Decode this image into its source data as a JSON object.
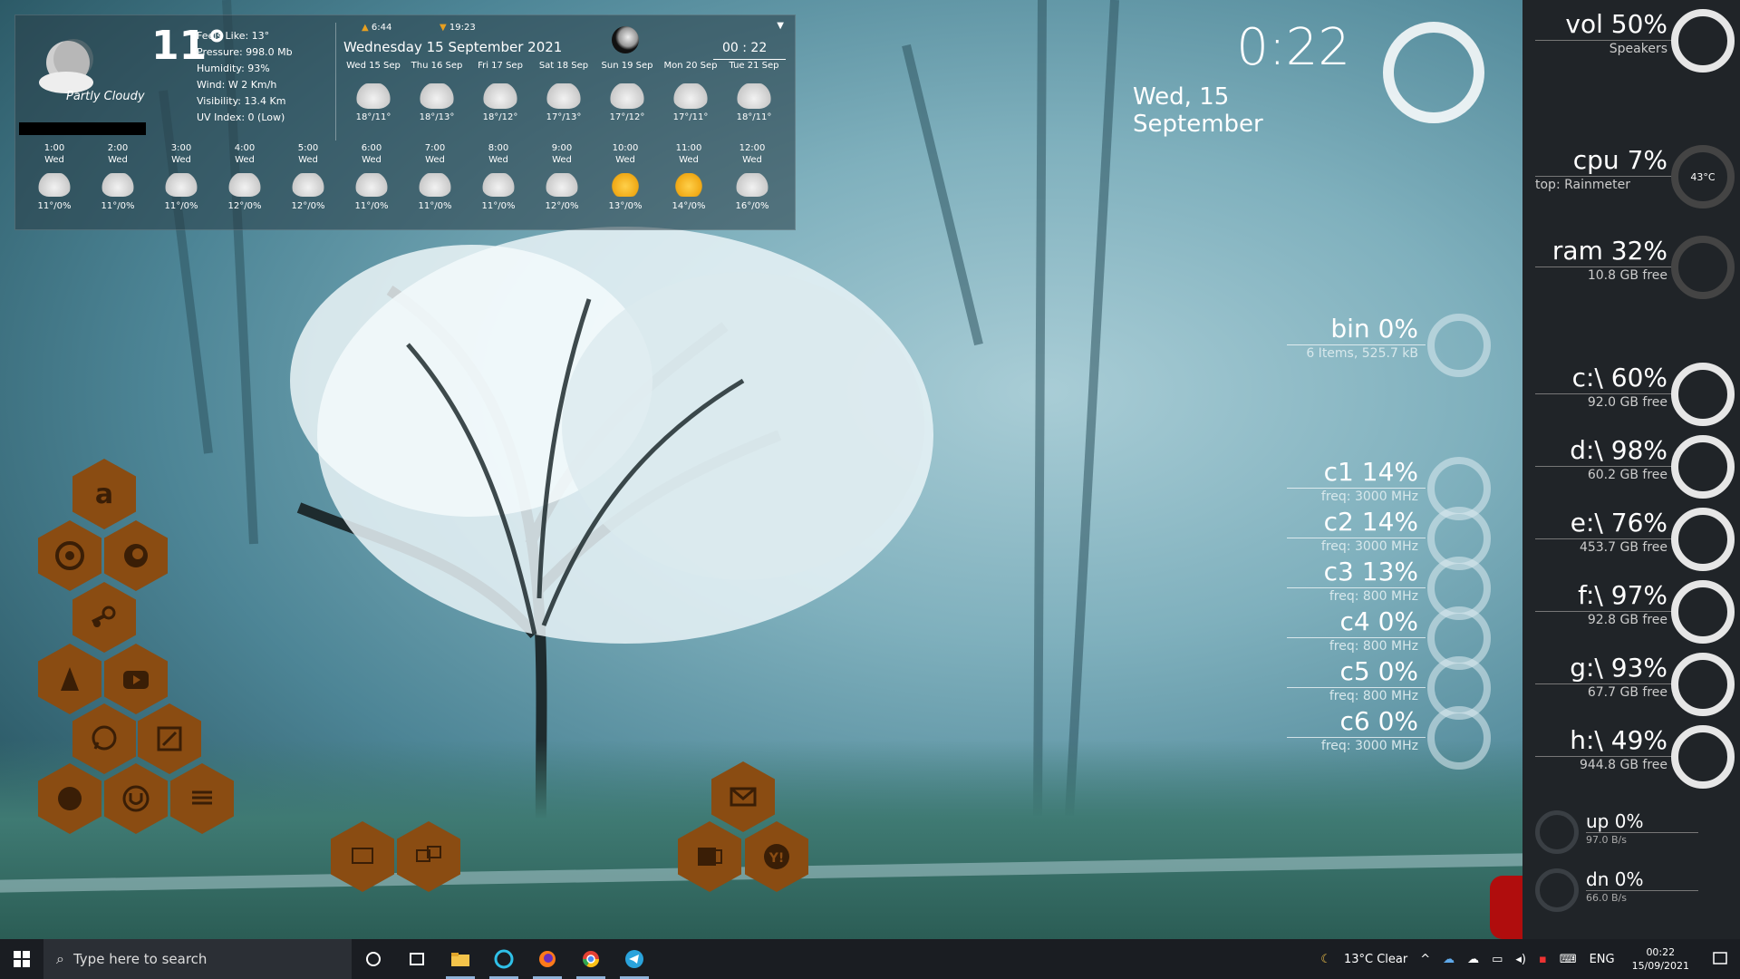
{
  "weather": {
    "temp": "11°",
    "condition": "Partly Cloudy",
    "details": [
      "Feels Like: 13°",
      "Pressure: 998.0 Mb",
      "Humidity: 93%",
      "Wind: W 2 Km/h",
      "Visibility: 13.4 Km",
      "UV Index: 0 (Low)"
    ],
    "sunrise": "6:44",
    "sunset": "19:23",
    "date": "Wednesday  15 September  2021",
    "clock": "00 : 22",
    "daily": [
      {
        "day": "Wed 15 Sep",
        "temps": "18°/11°"
      },
      {
        "day": "Thu 16 Sep",
        "temps": "18°/13°"
      },
      {
        "day": "Fri 17 Sep",
        "temps": "18°/12°"
      },
      {
        "day": "Sat 18 Sep",
        "temps": "17°/13°"
      },
      {
        "day": "Sun 19 Sep",
        "temps": "17°/12°"
      },
      {
        "day": "Mon 20 Sep",
        "temps": "17°/11°"
      },
      {
        "day": "Tue 21 Sep",
        "temps": "18°/11°"
      }
    ],
    "hourly": [
      {
        "time": "1:00",
        "day": "Wed",
        "val": "11°/0%",
        "icon": "cloud"
      },
      {
        "time": "2:00",
        "day": "Wed",
        "val": "11°/0%",
        "icon": "cloud"
      },
      {
        "time": "3:00",
        "day": "Wed",
        "val": "11°/0%",
        "icon": "cloud"
      },
      {
        "time": "4:00",
        "day": "Wed",
        "val": "12°/0%",
        "icon": "cloud"
      },
      {
        "time": "5:00",
        "day": "Wed",
        "val": "12°/0%",
        "icon": "cloud"
      },
      {
        "time": "6:00",
        "day": "Wed",
        "val": "11°/0%",
        "icon": "cloud"
      },
      {
        "time": "7:00",
        "day": "Wed",
        "val": "11°/0%",
        "icon": "cloud"
      },
      {
        "time": "8:00",
        "day": "Wed",
        "val": "11°/0%",
        "icon": "cloud"
      },
      {
        "time": "9:00",
        "day": "Wed",
        "val": "12°/0%",
        "icon": "cloud"
      },
      {
        "time": "10:00",
        "day": "Wed",
        "val": "13°/0%",
        "icon": "sun"
      },
      {
        "time": "11:00",
        "day": "Wed",
        "val": "14°/0%",
        "icon": "sun"
      },
      {
        "time": "12:00",
        "day": "Wed",
        "val": "16°/0%",
        "icon": "cloud"
      }
    ]
  },
  "clock": {
    "time": "0:22",
    "date": "Wed, 15 September"
  },
  "sidebar": {
    "vol": {
      "label": "vol 50%",
      "sub": "Speakers"
    },
    "cpu": {
      "label": "cpu 7%",
      "sub": "top: Rainmeter",
      "temp": "43°C"
    },
    "ram": {
      "label": "ram 32%",
      "sub": "10.8 GB free"
    },
    "drives": [
      {
        "label": "c:\\ 60%",
        "sub": "92.0 GB free"
      },
      {
        "label": "d:\\ 98%",
        "sub": "60.2 GB free"
      },
      {
        "label": "e:\\ 76%",
        "sub": "453.7 GB free"
      },
      {
        "label": "f:\\ 97%",
        "sub": "92.8 GB free"
      },
      {
        "label": "g:\\ 93%",
        "sub": "67.7 GB free"
      },
      {
        "label": "h:\\ 49%",
        "sub": "944.8 GB free"
      }
    ],
    "up": {
      "label": "up 0%",
      "sub": "97.0 B/s"
    },
    "dn": {
      "label": "dn 0%",
      "sub": "66.0 B/s"
    }
  },
  "bin": {
    "label": "bin 0%",
    "sub": "6 Items, 525.7 kB"
  },
  "cores": [
    {
      "label": "c1 14%",
      "sub": "freq: 3000 MHz"
    },
    {
      "label": "c2 14%",
      "sub": "freq: 3000 MHz"
    },
    {
      "label": "c3 13%",
      "sub": "freq: 800 MHz"
    },
    {
      "label": "c4 0%",
      "sub": "freq: 800 MHz"
    },
    {
      "label": "c5 0%",
      "sub": "freq: 800 MHz"
    },
    {
      "label": "c6 0%",
      "sub": "freq: 3000 MHz"
    }
  ],
  "taskbar": {
    "search_placeholder": "Type here to search",
    "weather": "13°C  Clear",
    "lang": "ENG",
    "time": "00:22",
    "date": "15/09/2021"
  },
  "colors": {
    "hex": "#8a4c12",
    "sidebar": "#202428"
  }
}
